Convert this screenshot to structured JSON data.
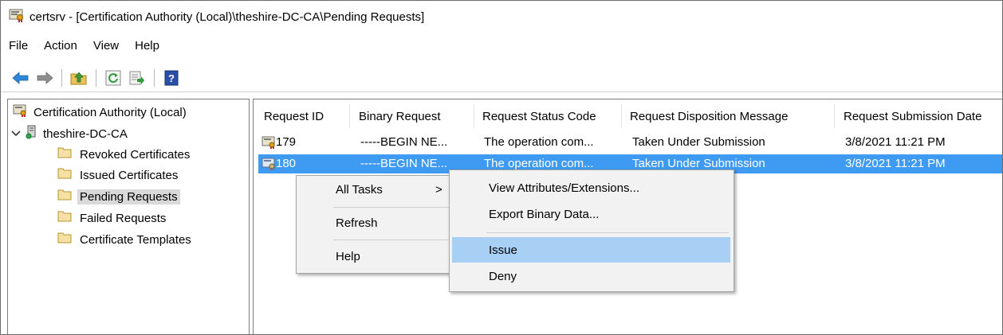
{
  "window": {
    "title": "certsrv - [Certification Authority (Local)\\theshire-DC-CA\\Pending Requests]"
  },
  "menubar": {
    "items": [
      "File",
      "Action",
      "View",
      "Help"
    ]
  },
  "toolbar": {
    "buttons": [
      "back-arrow-icon",
      "forward-arrow-icon",
      "up-folder-icon",
      "refresh-icon",
      "export-list-icon",
      "help-icon"
    ]
  },
  "tree": {
    "root": "Certification Authority (Local)",
    "ca": "theshire-DC-CA",
    "folders": [
      "Revoked Certificates",
      "Issued Certificates",
      "Pending Requests",
      "Failed Requests",
      "Certificate Templates"
    ],
    "selected": "Pending Requests"
  },
  "list": {
    "columns": [
      "Request ID",
      "Binary Request",
      "Request Status Code",
      "Request Disposition Message",
      "Request Submission Date"
    ],
    "rows": [
      {
        "id": "179",
        "binary": "-----BEGIN NE...",
        "status": "The operation com...",
        "disposition": "Taken Under Submission",
        "date": "3/8/2021 11:21 PM"
      },
      {
        "id": "180",
        "binary": "-----BEGIN NE...",
        "status": "The operation com...",
        "disposition": "Taken Under Submission",
        "date": "3/8/2021 11:21 PM"
      }
    ],
    "selected_row": "180"
  },
  "context_menu": {
    "all_tasks": "All Tasks",
    "all_tasks_arrow": ">",
    "refresh": "Refresh",
    "help": "Help"
  },
  "submenu": {
    "view_attributes": "View Attributes/Extensions...",
    "export_binary": "Export Binary Data...",
    "issue": "Issue",
    "deny": "Deny",
    "highlighted": "Issue"
  },
  "colors": {
    "selection": "#3f9af2",
    "menu_highlight": "#a8d0f5",
    "menu_bg": "#f2f2f2"
  }
}
